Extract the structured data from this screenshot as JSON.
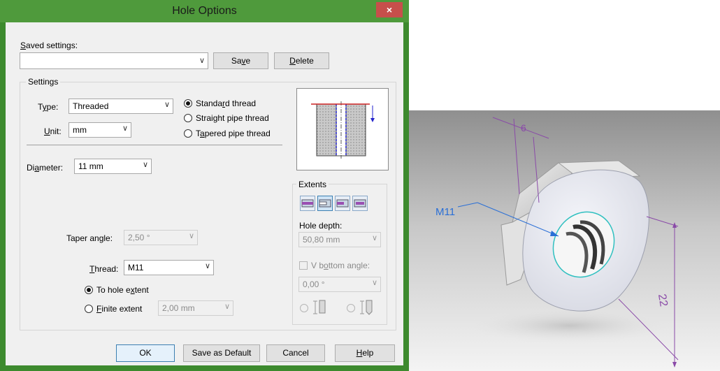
{
  "dialog": {
    "title": "Hole Options",
    "close_label": "×",
    "saved_settings": {
      "label_u": "S",
      "label_rest": "aved settings:",
      "value": ""
    },
    "save_btn": {
      "pre": "Sa",
      "u": "v",
      "post": "e"
    },
    "delete_btn": {
      "u": "D",
      "post": "elete"
    },
    "settings": {
      "group_label": "Settings",
      "type": {
        "label_pre": "T",
        "label_u": "y",
        "label_post": "pe:",
        "value": "Threaded"
      },
      "unit": {
        "label_u": "U",
        "label_post": "nit:",
        "value": "mm"
      },
      "thread_types": [
        {
          "pre": "Standa",
          "u": "r",
          "post": "d thread",
          "selected": true
        },
        {
          "pre": "Strai",
          "u": "g",
          "post": "ht pipe thread",
          "selected": false
        },
        {
          "pre": "T",
          "u": "a",
          "post": "pered pipe thread",
          "selected": false
        }
      ],
      "diameter": {
        "label_pre": "Di",
        "label_u": "a",
        "label_post": "meter:",
        "value": "11 mm"
      },
      "taper_angle": {
        "label": "Taper angle:",
        "value": "2,50 °"
      },
      "thread": {
        "label_u": "T",
        "label_post": "hread:",
        "value": "M11"
      },
      "to_hole_extent": {
        "pre": "To hole e",
        "u": "x",
        "post": "tent",
        "selected": true
      },
      "finite_extent": {
        "u": "F",
        "post": "inite extent",
        "value": "2,00 mm",
        "selected": false
      }
    },
    "extents": {
      "label": "Extents",
      "hole_depth": {
        "label": "Hole depth:",
        "value": "50,80 mm"
      },
      "v_bottom": {
        "pre": "V b",
        "u": "o",
        "post": "ttom angle:",
        "value": "0,00 °"
      }
    },
    "buttons": {
      "ok": "OK",
      "save_default": "Save as Default",
      "cancel": "Cancel",
      "help_u": "H",
      "help_post": "elp"
    }
  },
  "view3d": {
    "dim_top": "6",
    "dim_side": "22",
    "thread_callout": "M11"
  },
  "colors": {
    "title_bar": "#4f9a3c",
    "close": "#c74f4b",
    "dimension": "#8a4aa8",
    "callout": "#2a6fd6"
  }
}
